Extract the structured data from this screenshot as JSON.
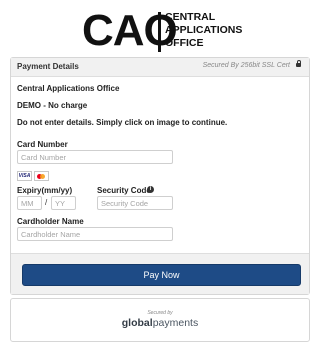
{
  "logo": {
    "acronym": "CAO",
    "line1": "CENTRAL",
    "line2": "APPLICATIONS",
    "line3": "OFFICE"
  },
  "panel": {
    "title": "Payment Details",
    "secure_text": "Secured By 256bit SSL Cert"
  },
  "info": {
    "merchant": "Central Applications Office",
    "demo": "DEMO - No charge",
    "notice": "Do not enter details. Simply click on image to continue."
  },
  "card_number": {
    "label": "Card Number",
    "placeholder": "Card Number",
    "value": ""
  },
  "card_brands": [
    "VISA",
    "mastercard"
  ],
  "expiry": {
    "label": "Expiry(mm/yy)",
    "month_placeholder": "MM",
    "year_placeholder": "YY",
    "separator": "/"
  },
  "security_code": {
    "label": "Security Code",
    "placeholder": "Security Code",
    "info_icon": "info-icon"
  },
  "cardholder": {
    "label": "Cardholder Name",
    "placeholder": "Cardholder Name"
  },
  "pay_button": {
    "label": "Pay Now"
  },
  "badge": {
    "secured_by": "Secured by",
    "brand_bold": "global",
    "brand_rest": "payments"
  },
  "colors": {
    "pay_button": "#1e4b86",
    "panel_header": "#f1f1f1"
  }
}
